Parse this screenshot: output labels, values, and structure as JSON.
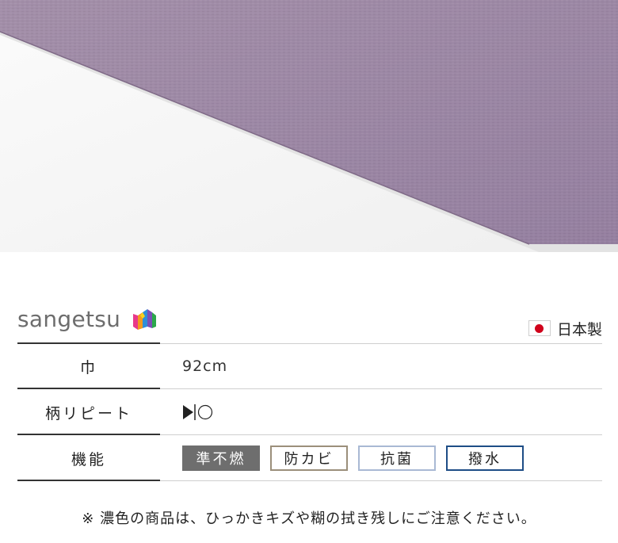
{
  "photo": {
    "description_colors": {
      "sheet": "#9c86a3",
      "sheet_edge": "#8b7392",
      "background": "#f5f5f5"
    }
  },
  "brand": {
    "logo_text": "sangetsu",
    "origin_text": "日本製",
    "origin_icon": "japan-flag-icon"
  },
  "specs": [
    {
      "label": "巾",
      "value": "92cm"
    },
    {
      "label": "柄リピート",
      "value_icon": "repeat-none-icon"
    },
    {
      "label": "機能"
    }
  ],
  "features": [
    "準不燃",
    "防カビ",
    "抗菌",
    "撥水"
  ],
  "feature_colors": {
    "準不燃": "#6e6e6e",
    "防カビ": "#9b8f7b",
    "抗菌": "#a9b9d4",
    "撥水": "#1e4d86"
  },
  "note": "※ 濃色の商品は、ひっかきキズや糊の拭き残しにご注意ください。"
}
